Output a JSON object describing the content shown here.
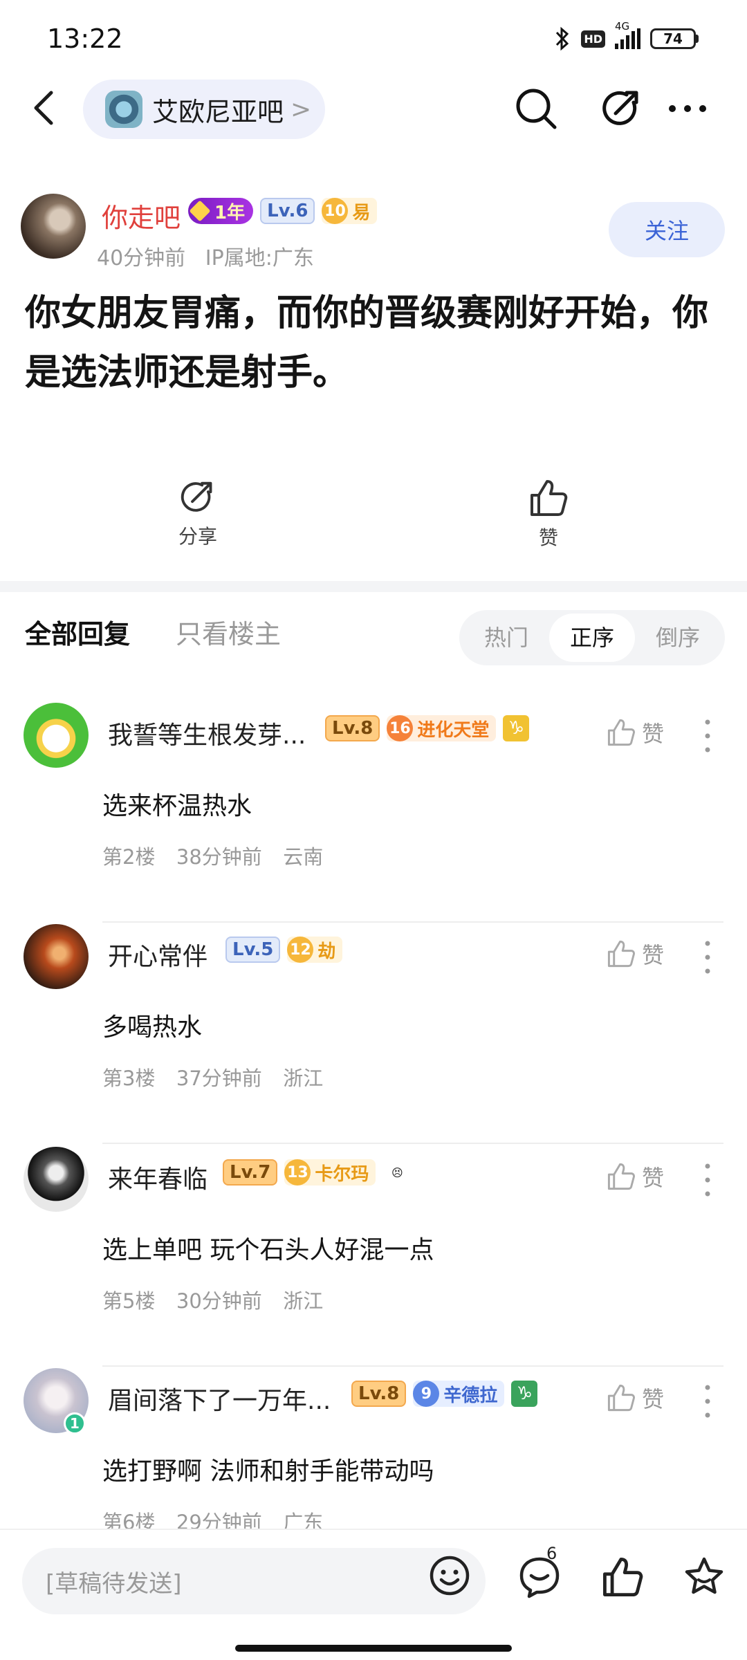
{
  "status": {
    "time": "13:22",
    "hd": "HD",
    "network": "4G",
    "battery": "74"
  },
  "nav": {
    "forum_name": "艾欧尼亚吧",
    "chevron": ">"
  },
  "author": {
    "name": "你走吧",
    "year_badge": "1年",
    "level": "Lv.6",
    "rank_num": "10",
    "rank_name": "易",
    "time": "40分钟前",
    "ip": "IP属地:广东",
    "follow_label": "关注"
  },
  "post": {
    "title": "你女朋友胃痛，而你的晋级赛刚好开始，你是选法师还是射手。"
  },
  "actions": {
    "share_label": "分享",
    "like_label": "赞"
  },
  "tabs": {
    "all": "全部回复",
    "op_only": "只看楼主",
    "sort": [
      "热门",
      "正序",
      "倒序"
    ],
    "active_sort": "正序"
  },
  "comments": [
    {
      "name": "我誓等生根发芽...",
      "level": "Lv.8",
      "rank_num": "16",
      "rank_name": "进化天堂",
      "extra": "♑",
      "body": "选来杯温热水",
      "floor": "第2楼",
      "time": "38分钟前",
      "ip": "云南",
      "like": "赞"
    },
    {
      "name": "开心常伴",
      "level": "Lv.5",
      "rank_num": "12",
      "rank_name": "劫",
      "body": "多喝热水",
      "floor": "第3楼",
      "time": "37分钟前",
      "ip": "浙江",
      "like": "赞"
    },
    {
      "name": "来年春临",
      "level": "Lv.7",
      "rank_num": "13",
      "rank_name": "卡尔玛",
      "extra": "😣",
      "body": "选上单吧 玩个石头人好混一点",
      "floor": "第5楼",
      "time": "30分钟前",
      "ip": "浙江",
      "like": "赞"
    },
    {
      "name": "眉间落下了一万年...",
      "level": "Lv.8",
      "rank_num": "9",
      "rank_name": "辛德拉",
      "extra": "♑",
      "body": "选打野啊 法师和射手能带动吗",
      "floor": "第6楼",
      "time": "29分钟前",
      "ip": "广东",
      "like": "赞",
      "avatar_badge": "1"
    }
  ],
  "bottom": {
    "draft_placeholder": "[草稿待发送]",
    "comment_count": "6"
  },
  "colors": {
    "accent": "#3b63d6",
    "author_name": "#e0403c"
  }
}
